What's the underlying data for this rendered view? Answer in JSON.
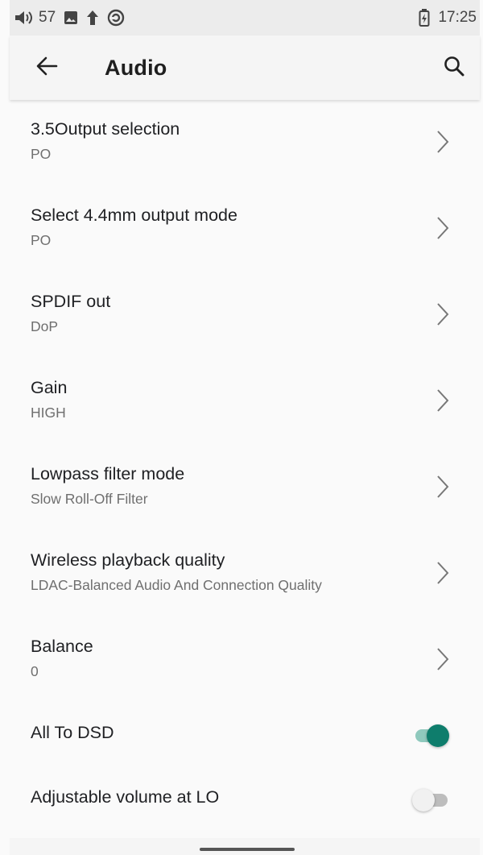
{
  "status_bar": {
    "volume_level": "57",
    "time": "17:25",
    "icons": [
      "volume-icon",
      "image-icon",
      "upload-icon",
      "sync-icon",
      "battery-charging-icon"
    ]
  },
  "app_bar": {
    "title": "Audio",
    "back_icon": "arrow-left-icon",
    "search_icon": "search-icon"
  },
  "settings": [
    {
      "title": "3.5Output selection",
      "value": "PO"
    },
    {
      "title": "Select 4.4mm output mode",
      "value": "PO"
    },
    {
      "title": "SPDIF out",
      "value": "DoP"
    },
    {
      "title": "Gain",
      "value": "HIGH"
    },
    {
      "title": "Lowpass filter mode",
      "value": "Slow Roll-Off Filter"
    },
    {
      "title": "Wireless playback quality",
      "value": "LDAC-Balanced Audio And Connection Quality"
    },
    {
      "title": "Balance",
      "value": "0"
    }
  ],
  "toggles": [
    {
      "title": "All To DSD",
      "state": "on"
    },
    {
      "title": "Adjustable volume at LO",
      "state": "off"
    }
  ],
  "colors": {
    "accent": "#0e7d6c",
    "accent_track": "#8fc9bd"
  }
}
